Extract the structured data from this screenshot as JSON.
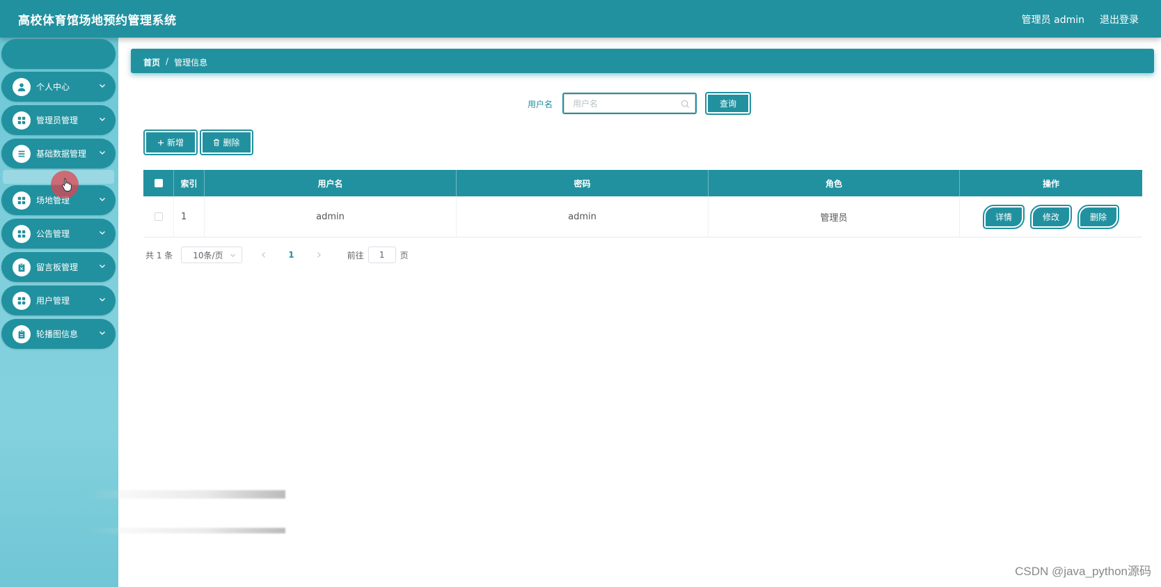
{
  "header": {
    "title": "高校体育馆场地预约管理系统",
    "user_label": "管理员 admin",
    "logout_label": "退出登录"
  },
  "sidebar": {
    "home": "首页",
    "items": [
      {
        "label": "个人中心",
        "icon": "user-icon"
      },
      {
        "label": "管理员管理",
        "icon": "grid-icon"
      },
      {
        "label": "基础数据管理",
        "icon": "list-icon"
      },
      {
        "label": "场地管理",
        "icon": "grid-icon"
      },
      {
        "label": "公告管理",
        "icon": "grid-icon"
      },
      {
        "label": "留言板管理",
        "icon": "clipboard-icon"
      },
      {
        "label": "用户管理",
        "icon": "grid-icon"
      },
      {
        "label": "轮播图信息",
        "icon": "clipboard-icon"
      }
    ]
  },
  "breadcrumb": {
    "home": "首页",
    "separator": "/",
    "current": "管理信息"
  },
  "search": {
    "label": "用户名",
    "placeholder": "用户名",
    "query_label": "查询"
  },
  "actions": {
    "add_label": "新增",
    "delete_label": "删除"
  },
  "table": {
    "columns": [
      "索引",
      "用户名",
      "密码",
      "角色",
      "操作"
    ],
    "rows": [
      {
        "index": "1",
        "username": "admin",
        "password": "admin",
        "role": "管理员"
      }
    ],
    "row_actions": {
      "detail": "详情",
      "edit": "修改",
      "delete": "删除"
    }
  },
  "pagination": {
    "total": "共 1 条",
    "page_size": "10条/页",
    "current_page": "1",
    "goto_label": "前往",
    "goto_value": "1",
    "page_suffix": "页"
  },
  "watermark": "CSDN @java_python源码",
  "colors": {
    "primary": "#21919f",
    "sidebar_bg": "#7fcfdc"
  }
}
